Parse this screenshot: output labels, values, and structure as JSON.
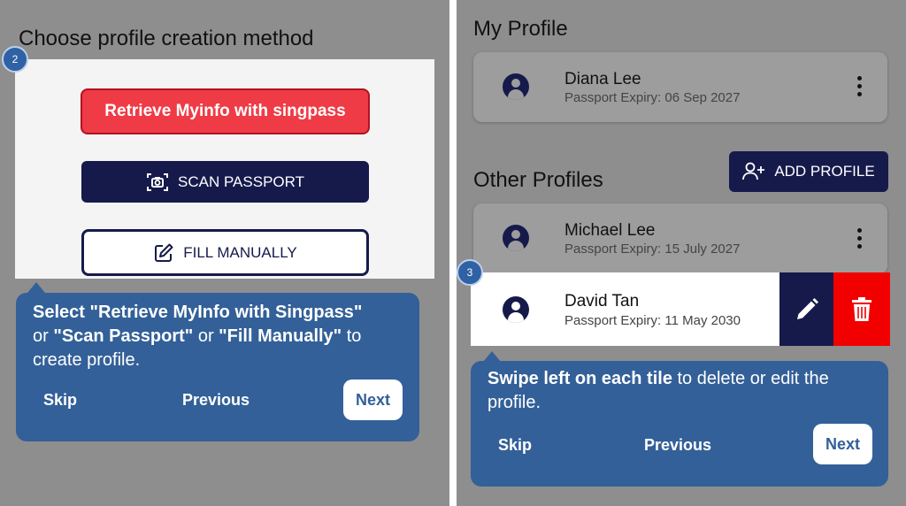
{
  "left_screen": {
    "heading": "Choose profile creation method",
    "step_number": "2",
    "buttons": {
      "singpass": "Retrieve Myinfo with singpass",
      "scan_passport": "SCAN PASSPORT",
      "fill_manually": "FILL MANUALLY"
    },
    "tooltip": {
      "text_1": "Select \"Retrieve MyInfo with Singpass\"",
      "text_2": "or ",
      "text_3": "\"Scan Passport\"",
      "text_4": " or ",
      "text_5": "\"Fill Manually\"",
      "text_6": " to",
      "text_7": "create profile.",
      "skip": "Skip",
      "previous": "Previous",
      "next": "Next"
    }
  },
  "right_screen": {
    "my_profile_heading": "My Profile",
    "my_profile": {
      "name": "Diana Lee",
      "expiry": "Passport Expiry: 06 Sep 2027"
    },
    "other_profiles_heading": "Other Profiles",
    "add_profile_label": "ADD PROFILE",
    "other_profiles": [
      {
        "name": "Michael Lee",
        "expiry": "Passport Expiry: 15 July 2027"
      },
      {
        "name": "David Tan",
        "expiry": "Passport Expiry: 11 May 2030"
      }
    ],
    "step_number": "3",
    "tooltip": {
      "text_bold": "Swipe left on each tile",
      "text_rest": " to delete or edit the",
      "text_line2": "profile.",
      "skip": "Skip",
      "previous": "Previous",
      "next": "Next"
    }
  },
  "colors": {
    "overlay_gray": "#8e8e8e",
    "navy": "#161a4b",
    "singpass_red": "#ef3b46",
    "tooltip_blue": "#336098",
    "delete_red": "#f20000"
  },
  "icons": [
    "camera-scan-icon",
    "pencil-square-icon",
    "user-avatar-icon",
    "kebab-menu-icon",
    "add-user-icon",
    "pencil-icon",
    "trash-icon"
  ]
}
